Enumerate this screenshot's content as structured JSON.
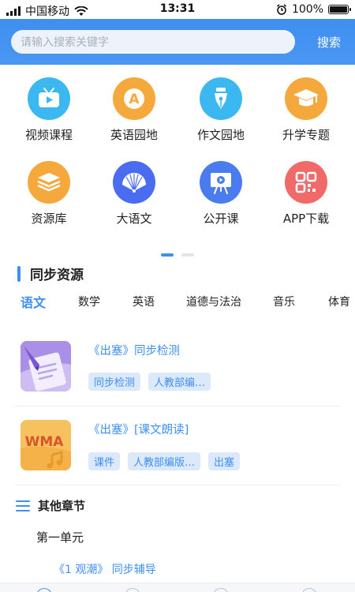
{
  "status_bar": {
    "carrier": "中国移动",
    "time": "13:31",
    "battery": "100%"
  },
  "search": {
    "placeholder": "请输入搜索关键字",
    "button_label": "搜索"
  },
  "grid": [
    {
      "label": "视频课程",
      "icon": "tv-play-icon",
      "color": "#3cb8f0"
    },
    {
      "label": "英语园地",
      "icon": "letter-a-icon",
      "color": "#f5a93c"
    },
    {
      "label": "作文园地",
      "icon": "pen-nib-icon",
      "color": "#3cb8f0"
    },
    {
      "label": "升学专题",
      "icon": "graduation-cap-icon",
      "color": "#f5a93c"
    },
    {
      "label": "资源库",
      "icon": "layers-icon",
      "color": "#f5a93c"
    },
    {
      "label": "大语文",
      "icon": "folding-fan-icon",
      "color": "#4a6cf0"
    },
    {
      "label": "公开课",
      "icon": "presentation-board-icon",
      "color": "#4a7cf0"
    },
    {
      "label": "APP下载",
      "icon": "qr-code-icon",
      "color": "#f06a6a"
    }
  ],
  "pager": {
    "pages": 2,
    "active": 0
  },
  "section": {
    "title": "同步资源"
  },
  "subjects": [
    "语文",
    "数学",
    "英语",
    "道德与法治",
    "音乐",
    "体育"
  ],
  "active_subject": 0,
  "resources": [
    {
      "title": "《出塞》同步检测",
      "thumb": "document-pen-icon",
      "tags": [
        "同步检测",
        "人教部编…"
      ]
    },
    {
      "title": "《出塞》[课文朗读]",
      "thumb": "wma-audio-icon",
      "thumb_text": "WMA",
      "tags": [
        "课件",
        "人教部编版…",
        "出塞"
      ]
    }
  ],
  "chapters": {
    "title": "其他章节",
    "unit": "第一单元",
    "item": "《1 观潮》 同步辅导"
  },
  "colors": {
    "accent": "#3f8ff0",
    "header": "#4a96f2"
  }
}
